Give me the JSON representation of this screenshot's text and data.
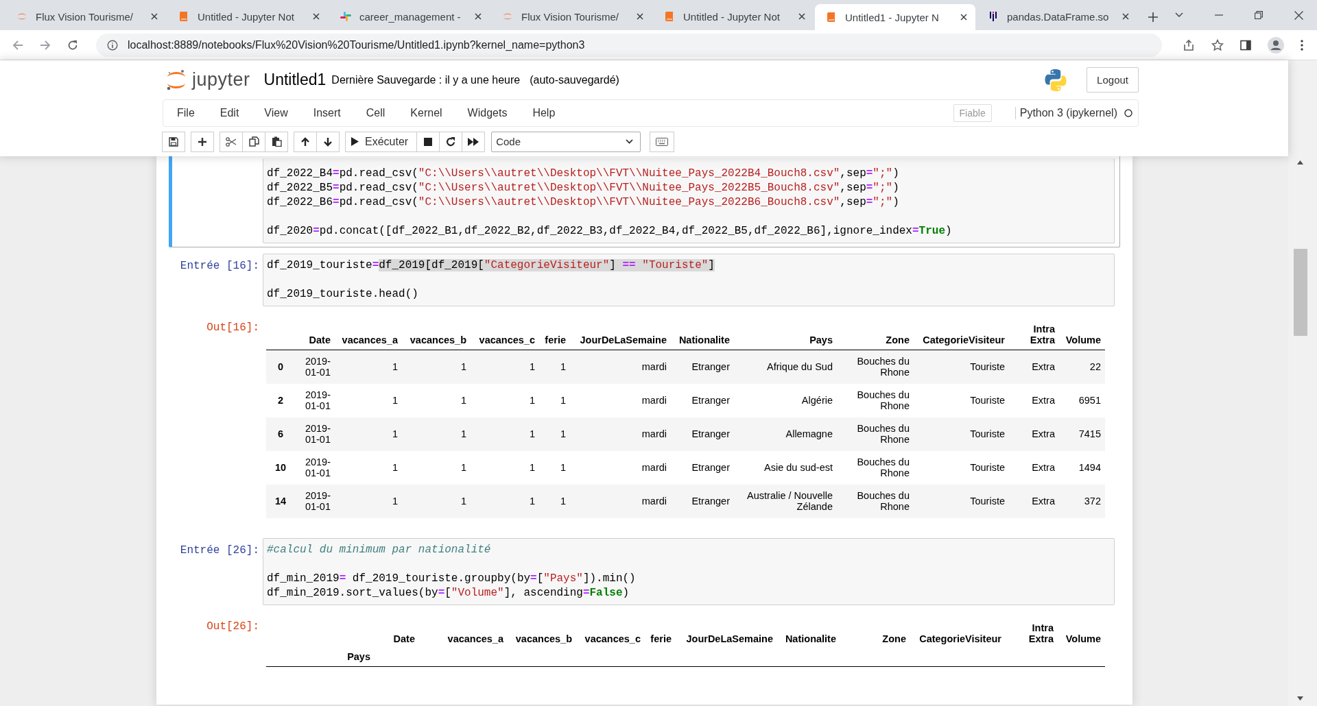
{
  "browser": {
    "tabs": [
      {
        "title": "Flux Vision Tourisme/",
        "kind": "ring",
        "selected": false
      },
      {
        "title": "Untitled - Jupyter Not",
        "kind": "book",
        "selected": false
      },
      {
        "title": "career_management -",
        "kind": "hash",
        "selected": false
      },
      {
        "title": "Flux Vision Tourisme/",
        "kind": "ring",
        "selected": false
      },
      {
        "title": "Untitled - Jupyter Not",
        "kind": "book",
        "selected": false
      },
      {
        "title": "Untitled1 - Jupyter N",
        "kind": "book",
        "selected": true
      },
      {
        "title": "pandas.DataFrame.so",
        "kind": "bars",
        "selected": false
      }
    ],
    "url": "localhost:8889/notebooks/Flux%20Vision%20Tourisme/Untitled1.ipynb?kernel_name=python3"
  },
  "notebook": {
    "logo_text": "jupyter",
    "title": "Untitled1",
    "checkpoint": "Dernière Sauvegarde : il y a une heure",
    "autosave": "(auto-sauvegardé)",
    "logout": "Logout",
    "menu": [
      "File",
      "Edit",
      "View",
      "Insert",
      "Cell",
      "Kernel",
      "Widgets",
      "Help"
    ],
    "trusted": "Fiable",
    "kernel": "Python 3 (ipykernel)",
    "run_label": "Exécuter",
    "cell_type": "Code"
  },
  "cells": [
    {
      "kind": "code",
      "selected": true,
      "blocks": [
        [
          [
            {
              "text": "df_2022_B4",
              "kind": "name"
            },
            {
              "text": "=",
              "kind": "op"
            },
            {
              "text": "pd.read_csv(",
              "kind": "name"
            },
            {
              "text": "\"C:\\\\Users\\\\autret\\\\Desktop\\\\FVT\\\\Nuitee_Pays_2022B4_Bouch8.csv\"",
              "kind": "string"
            },
            {
              "text": ",sep",
              "kind": "name"
            },
            {
              "text": "=",
              "kind": "op"
            },
            {
              "text": "\";\"",
              "kind": "string"
            },
            {
              "text": ")",
              "kind": "name"
            }
          ],
          [
            {
              "text": "df_2022_B5",
              "kind": "name"
            },
            {
              "text": "=",
              "kind": "op"
            },
            {
              "text": "pd.read_csv(",
              "kind": "name"
            },
            {
              "text": "\"C:\\\\Users\\\\autret\\\\Desktop\\\\FVT\\\\Nuitee_Pays_2022B5_Bouch8.csv\"",
              "kind": "string"
            },
            {
              "text": ",sep",
              "kind": "name"
            },
            {
              "text": "=",
              "kind": "op"
            },
            {
              "text": "\";\"",
              "kind": "string"
            },
            {
              "text": ")",
              "kind": "name"
            }
          ],
          [
            {
              "text": "df_2022_B6",
              "kind": "name"
            },
            {
              "text": "=",
              "kind": "op"
            },
            {
              "text": "pd.read_csv(",
              "kind": "name"
            },
            {
              "text": "\"C:\\\\Users\\\\autret\\\\Desktop\\\\FVT\\\\Nuitee_Pays_2022B6_Bouch8.csv\"",
              "kind": "string"
            },
            {
              "text": ",sep",
              "kind": "name"
            },
            {
              "text": "=",
              "kind": "op"
            },
            {
              "text": "\";\"",
              "kind": "string"
            },
            {
              "text": ")",
              "kind": "name"
            }
          ]
        ],
        [
          [
            {
              "text": "df_2020",
              "kind": "name"
            },
            {
              "text": "=",
              "kind": "op"
            },
            {
              "text": "pd.concat([df_2022_B1,df_2022_B2,df_2022_B3,df_2022_B4,df_2022_B5,df_2022_B6],ignore_index",
              "kind": "name"
            },
            {
              "text": "=",
              "kind": "op"
            },
            {
              "text": "True",
              "kind": "keyword"
            },
            {
              "text": ")",
              "kind": "name"
            }
          ]
        ]
      ]
    },
    {
      "kind": "code",
      "prompt": "Entrée [16]:",
      "selected": false,
      "blocks": [
        [
          [
            {
              "text": "df_2019_touriste",
              "kind": "name",
              "selected": false
            },
            {
              "text": "=",
              "kind": "op",
              "selected": false
            },
            {
              "text": "df_2019[df_2019[",
              "kind": "name",
              "selected": true
            },
            {
              "text": "\"CategorieVisiteur\"",
              "kind": "string",
              "selected": true
            },
            {
              "text": "] ",
              "kind": "name",
              "selected": true
            },
            {
              "text": "== ",
              "kind": "op",
              "selected": true
            },
            {
              "text": "\"Touriste\"",
              "kind": "string",
              "selected": true
            },
            {
              "text": "]",
              "kind": "name",
              "selected": true
            }
          ]
        ],
        [
          [
            {
              "text": "df_2019_touriste.head()",
              "kind": "name"
            }
          ]
        ]
      ]
    },
    {
      "kind": "table",
      "prompt": "Out[16]:",
      "columns": [
        "Date",
        "vacances_a",
        "vacances_b",
        "vacances_c",
        "ferie",
        "JourDeLaSemaine",
        "Nationalite",
        "Pays",
        "Zone",
        "CategorieVisiteur",
        "Intra Extra",
        "Volume"
      ],
      "rows": [
        {
          "index": "0",
          "cells": [
            "2019-01-01",
            "1",
            "1",
            "1",
            "1",
            "mardi",
            "Etranger",
            "Afrique du Sud",
            "Bouches du Rhone",
            "Touriste",
            "Extra",
            "22"
          ]
        },
        {
          "index": "2",
          "cells": [
            "2019-01-01",
            "1",
            "1",
            "1",
            "1",
            "mardi",
            "Etranger",
            "Algérie",
            "Bouches du Rhone",
            "Touriste",
            "Extra",
            "6951"
          ]
        },
        {
          "index": "6",
          "cells": [
            "2019-01-01",
            "1",
            "1",
            "1",
            "1",
            "mardi",
            "Etranger",
            "Allemagne",
            "Bouches du Rhone",
            "Touriste",
            "Extra",
            "7415"
          ]
        },
        {
          "index": "10",
          "cells": [
            "2019-01-01",
            "1",
            "1",
            "1",
            "1",
            "mardi",
            "Etranger",
            "Asie du sud-est",
            "Bouches du Rhone",
            "Touriste",
            "Extra",
            "1494"
          ]
        },
        {
          "index": "14",
          "cells": [
            "2019-01-01",
            "1",
            "1",
            "1",
            "1",
            "mardi",
            "Etranger",
            "Australie / Nouvelle Zélande",
            "Bouches du Rhone",
            "Touriste",
            "Extra",
            "372"
          ]
        }
      ]
    },
    {
      "kind": "code",
      "prompt": "Entrée [26]:",
      "selected": false,
      "blocks": [
        [
          [
            {
              "text": "#calcul du minimum par nationalité",
              "kind": "comment"
            }
          ]
        ],
        [
          [
            {
              "text": "df_min_2019",
              "kind": "name"
            },
            {
              "text": "=",
              "kind": "op"
            },
            {
              "text": " df_2019_touriste.groupby(by",
              "kind": "name"
            },
            {
              "text": "=",
              "kind": "op"
            },
            {
              "text": "[",
              "kind": "name"
            },
            {
              "text": "\"Pays\"",
              "kind": "string"
            },
            {
              "text": "]).min()",
              "kind": "name"
            }
          ],
          [
            {
              "text": "df_min_2019.sort_values(by",
              "kind": "name"
            },
            {
              "text": "=",
              "kind": "op"
            },
            {
              "text": "[",
              "kind": "name"
            },
            {
              "text": "\"Volume\"",
              "kind": "string"
            },
            {
              "text": "], ascending",
              "kind": "name"
            },
            {
              "text": "=",
              "kind": "op"
            },
            {
              "text": "False",
              "kind": "keyword"
            },
            {
              "text": ")",
              "kind": "name"
            }
          ]
        ]
      ]
    },
    {
      "kind": "table",
      "prompt": "Out[26]:",
      "index_name": "Pays",
      "columns": [
        "Date",
        "vacances_a",
        "vacances_b",
        "vacances_c",
        "ferie",
        "JourDeLaSemaine",
        "Nationalite",
        "Zone",
        "CategorieVisiteur",
        "Intra Extra",
        "Volume"
      ]
    }
  ]
}
